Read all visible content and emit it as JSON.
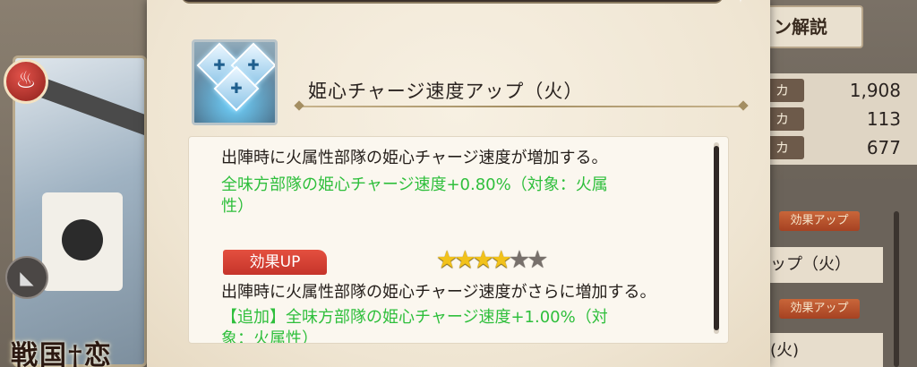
{
  "background": {
    "left_title": "戦国†恋",
    "explain_button": "ン解説",
    "stats": [
      {
        "label": "カ",
        "value": "1,908"
      },
      {
        "label": "カ",
        "value": "113"
      },
      {
        "label": "カ",
        "value": "677"
      }
    ],
    "effect_tag": "効果アップ",
    "sub_items": [
      "ップ（火）",
      "(火)"
    ]
  },
  "skill": {
    "title": "姫心チャージ速度アップ（火）",
    "desc_main": "出陣時に火属性部隊の姫心チャージ速度が増加する。",
    "desc_green_1": "全味方部隊の姫心チャージ速度+0.80%（対象：火属",
    "desc_green_2": "性）",
    "up_badge": "効果UP",
    "stars_filled": 4,
    "stars_total": 6,
    "up_desc_main": "出陣時に火属性部隊の姫心チャージ速度がさらに増加する。",
    "up_desc_green_1": "【追加】全味方部隊の姫心チャージ速度+1.00%（対",
    "up_desc_green_2": "象：火属性）"
  },
  "icons": {
    "close": "close-icon",
    "nav": "arrow-icon",
    "fire": "fire-icon",
    "skill": "diamond-crest-icon"
  }
}
